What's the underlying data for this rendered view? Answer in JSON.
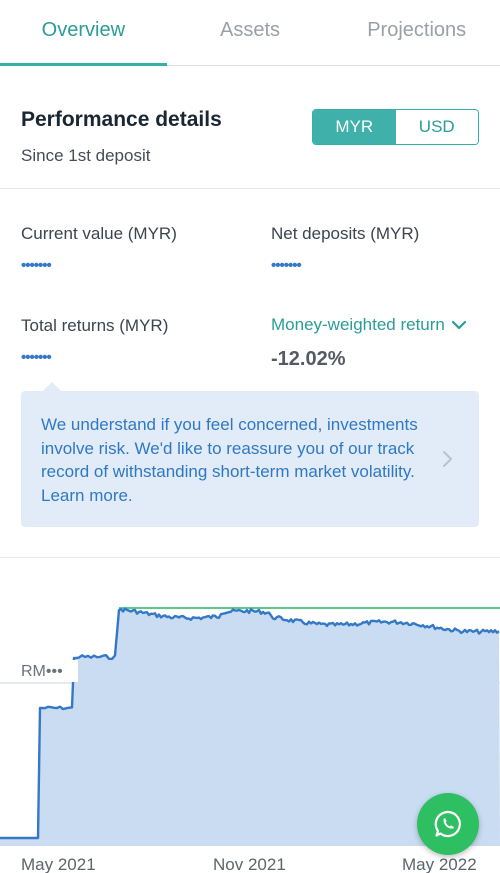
{
  "tabs": [
    {
      "label": "Overview",
      "active": true
    },
    {
      "label": "Assets",
      "active": false
    },
    {
      "label": "Projections",
      "active": false
    }
  ],
  "performance": {
    "title": "Performance details",
    "subtitle": "Since 1st deposit",
    "currency_options": [
      "MYR",
      "USD"
    ],
    "selected_currency": "MYR"
  },
  "metrics": {
    "current_value": {
      "label": "Current value (MYR)",
      "value": "•••••••"
    },
    "net_deposits": {
      "label": "Net deposits (MYR)",
      "value": "•••••••"
    },
    "total_returns": {
      "label": "Total returns (MYR)",
      "value": "•••••••"
    },
    "money_weighted": {
      "label": "Money-weighted return",
      "value": "-12.02%"
    }
  },
  "callout": {
    "text": "We understand if you feel concerned, investments involve risk. We'd like to reassure you of our track record of withstanding short-term market volatility. Learn more."
  },
  "chart_data": {
    "type": "area",
    "y_reference_label": "RM•••",
    "x_tick_labels": [
      "May 2021",
      "Nov 2021",
      "May 2022"
    ],
    "series": [
      {
        "color": "#3478c6"
      },
      {
        "color": "#5cc98a"
      }
    ]
  },
  "fab": {
    "icon": "whatsapp-icon"
  },
  "colors": {
    "accent": "#35b0a8",
    "chart_line": "#3478c6",
    "chart_fill": "#c9dcf2",
    "deposit_line": "#5cc98a",
    "fab": "#2fbf63"
  }
}
